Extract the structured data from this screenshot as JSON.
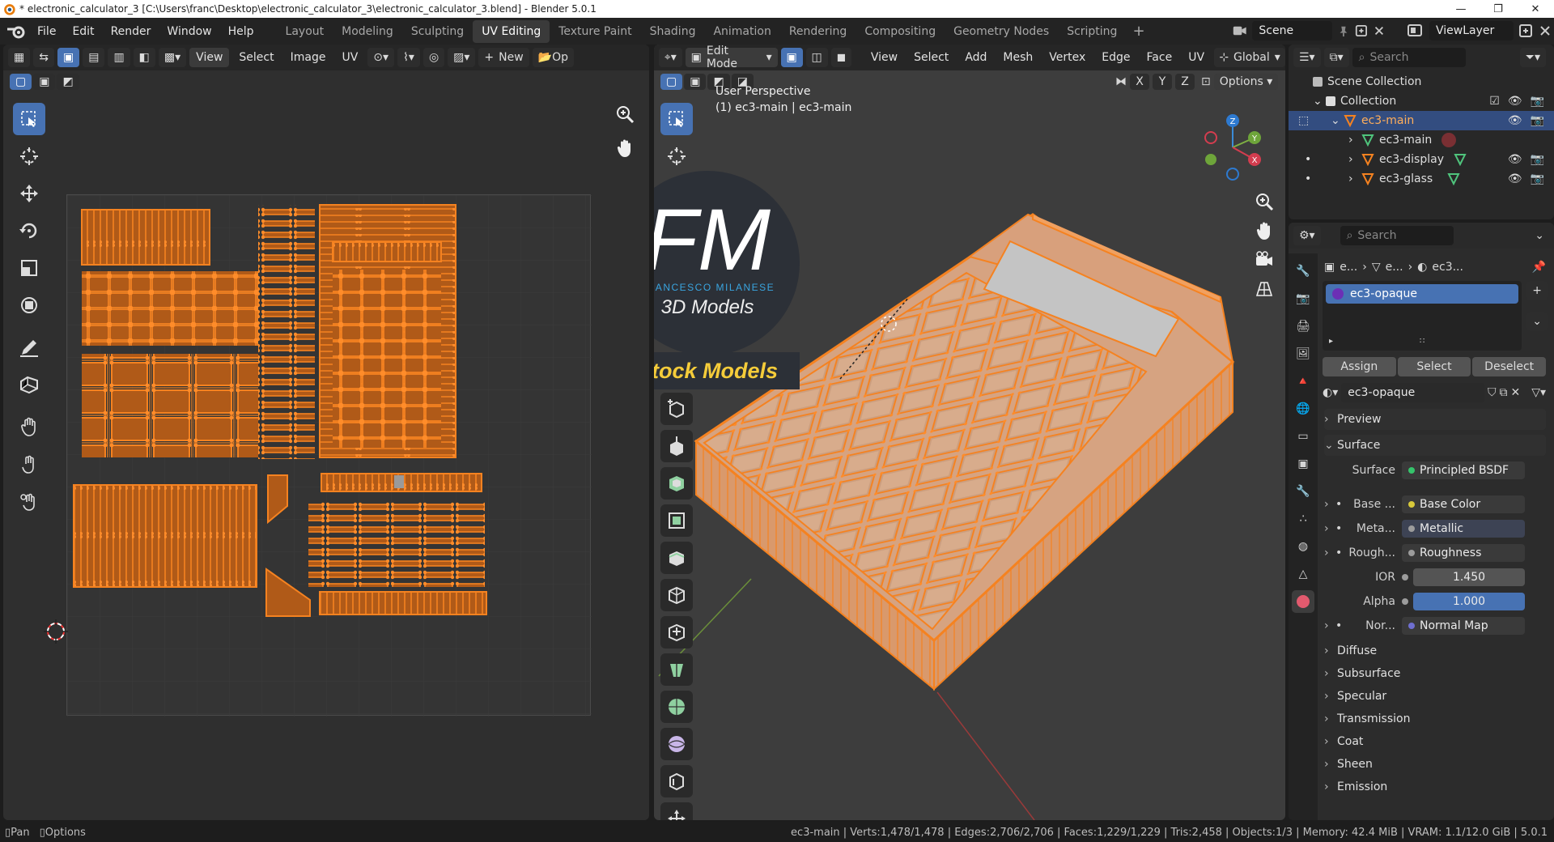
{
  "window": {
    "title": "* electronic_calculator_3 [C:\\Users\\franc\\Desktop\\electronic_calculator_3\\electronic_calculator_3.blend] - Blender 5.0.1",
    "controls": [
      "—",
      "❐",
      "✕"
    ]
  },
  "topbar": {
    "menus": [
      "File",
      "Edit",
      "Render",
      "Window",
      "Help"
    ],
    "workspaces": [
      "Layout",
      "Modeling",
      "Sculpting",
      "UV Editing",
      "Texture Paint",
      "Shading",
      "Animation",
      "Rendering",
      "Compositing",
      "Geometry Nodes",
      "Scripting"
    ],
    "active_workspace": "UV Editing",
    "scene": "Scene",
    "view_layer": "ViewLayer"
  },
  "uv_editor": {
    "menus": [
      "View",
      "Select",
      "Image",
      "UV"
    ],
    "new_button": "New",
    "op_label": "Op"
  },
  "viewport": {
    "mode": "Edit Mode",
    "menus": [
      "View",
      "Select",
      "Add",
      "Mesh",
      "Vertex",
      "Edge",
      "Face",
      "UV"
    ],
    "orientation": "Global",
    "options": "Options",
    "axes": [
      "X",
      "Y",
      "Z"
    ],
    "perspective": "User Perspective",
    "object_line": "(1) ec3-main | ec3-main",
    "gizmo_labels": [
      "Z",
      "Y",
      "X"
    ]
  },
  "watermark": {
    "initials": "FM",
    "name": "FRANCESCO MILANESE",
    "sub": "3D Models",
    "banner": "Stock Models"
  },
  "outliner": {
    "search_placeholder": "Search",
    "rows": [
      {
        "label": "Scene Collection"
      },
      {
        "label": "Collection"
      },
      {
        "label": "ec3-main"
      },
      {
        "label": "ec3-main"
      },
      {
        "label": "ec3-display"
      },
      {
        "label": "ec3-glass"
      }
    ]
  },
  "properties": {
    "search_placeholder": "Search",
    "breadcrumb": [
      "e...",
      "e...",
      "ec3..."
    ],
    "material_slot": "ec3-opaque",
    "slot_buttons": [
      "Assign",
      "Select",
      "Deselect"
    ],
    "material_name": "ec3-opaque",
    "sections": {
      "preview": "Preview",
      "surface": "Surface"
    },
    "surface_rows": [
      {
        "label": "Surface",
        "value": "Principled BSDF",
        "dot": "#35c46b"
      },
      {
        "label": "Base ...",
        "value": "Base Color",
        "dot": "#d8c93a"
      },
      {
        "label": "Meta...",
        "value": "Metallic",
        "dot": "#9c9c9c"
      },
      {
        "label": "Rough...",
        "value": "Roughness",
        "dot": "#9c9c9c"
      },
      {
        "label": "IOR",
        "value": "1.450",
        "dot": "#9c9c9c"
      },
      {
        "label": "Alpha",
        "value": "1.000",
        "dot": "#9c9c9c"
      },
      {
        "label": "Nor...",
        "value": "Normal Map",
        "dot": "#6f6fd0"
      }
    ],
    "collapsed": [
      "Diffuse",
      "Subsurface",
      "Specular",
      "Transmission",
      "Coat",
      "Sheen",
      "Emission"
    ]
  },
  "statusbar": {
    "pan": "Pan",
    "options": "Options",
    "stats": "ec3-main | Verts:1,478/1,478 | Edges:2,706/2,706 | Faces:1,229/1,229 | Tris:2,458 | Objects:1/3 | Memory: 42.4 MiB | VRAM: 1.1/12.0 GiB | 5.0.1"
  },
  "colors": {
    "accent": "#4772b3",
    "selection": "#f58220",
    "mesh_face": "#d9a27c"
  }
}
